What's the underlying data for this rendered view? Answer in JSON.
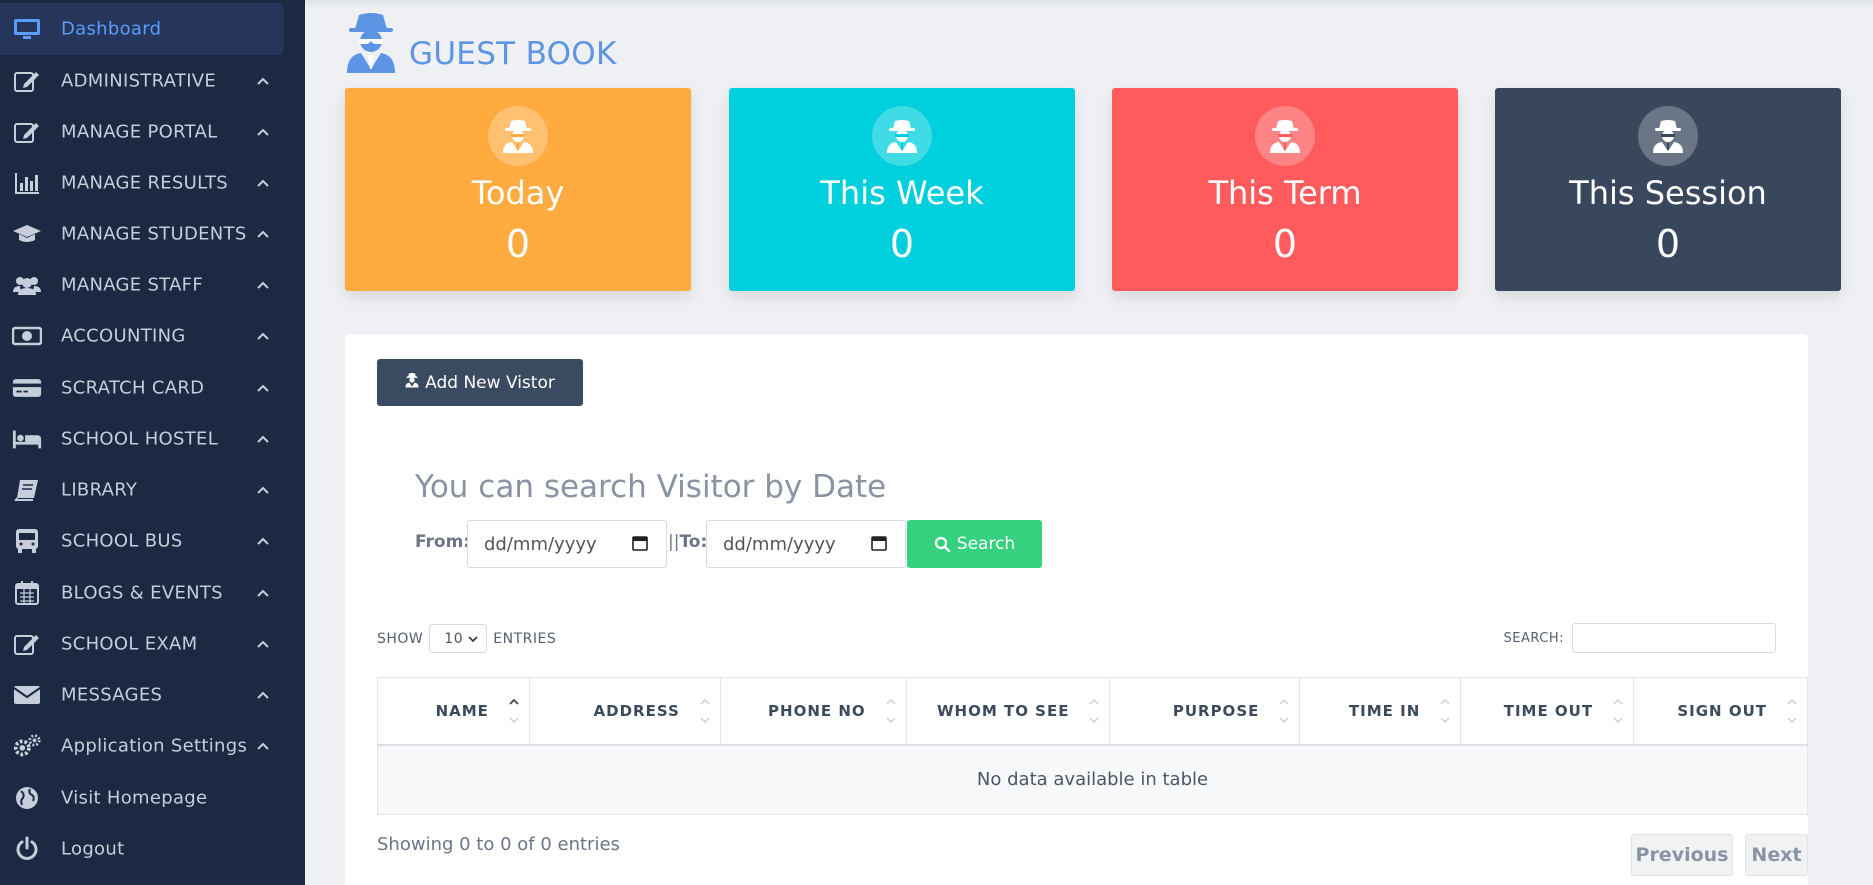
{
  "sidebar": {
    "items": [
      {
        "label": "Dashboard",
        "icon": "monitor-icon",
        "active": true,
        "chevron": false
      },
      {
        "label": "ADMINISTRATIVE",
        "icon": "edit-icon",
        "chevron": true
      },
      {
        "label": "MANAGE PORTAL",
        "icon": "edit-icon",
        "chevron": true
      },
      {
        "label": "MANAGE RESULTS",
        "icon": "bar-chart-icon",
        "chevron": true
      },
      {
        "label": "MANAGE STUDENTS",
        "icon": "graduation-cap-icon",
        "chevron": true
      },
      {
        "label": "MANAGE STAFF",
        "icon": "users-icon",
        "chevron": true
      },
      {
        "label": "ACCOUNTING",
        "icon": "money-icon",
        "chevron": true
      },
      {
        "label": "SCRATCH CARD",
        "icon": "credit-card-icon",
        "chevron": true
      },
      {
        "label": "SCHOOL HOSTEL",
        "icon": "bed-icon",
        "chevron": true
      },
      {
        "label": "LIBRARY",
        "icon": "book-icon",
        "chevron": true
      },
      {
        "label": "SCHOOL BUS",
        "icon": "bus-icon",
        "chevron": true
      },
      {
        "label": "BLOGS & EVENTS",
        "icon": "calendar-icon",
        "chevron": true
      },
      {
        "label": "SCHOOL EXAM",
        "icon": "edit-icon",
        "chevron": true
      },
      {
        "label": "MESSAGES",
        "icon": "envelope-icon",
        "chevron": true
      },
      {
        "label": "Application Settings",
        "icon": "gears-icon",
        "chevron": true
      },
      {
        "label": "Visit Homepage",
        "icon": "globe-icon",
        "chevron": false
      },
      {
        "label": "Logout",
        "icon": "power-icon",
        "chevron": false
      }
    ]
  },
  "header": {
    "title": "GUEST BOOK",
    "icon": "user-secret-icon"
  },
  "stats": [
    {
      "label": "Today",
      "value": "0",
      "color": "#ffab40"
    },
    {
      "label": "This Week",
      "value": "0",
      "color": "#00cfdd"
    },
    {
      "label": "This Term",
      "value": "0",
      "color": "#ff5b5c"
    },
    {
      "label": "This Session",
      "value": "0",
      "color": "#39475d"
    }
  ],
  "actions": {
    "add_visitor": "Add New Vistor"
  },
  "search": {
    "heading": "You can search Visitor by Date",
    "from_label": "From:",
    "separator": "||",
    "to_label": "To:",
    "date_placeholder": "dd/mm/yyyy",
    "button": "Search"
  },
  "table": {
    "show_label": "SHOW",
    "entries_value": "10",
    "entries_label": "ENTRIES",
    "search_label": "SEARCH:",
    "columns": [
      "NAME",
      "ADDRESS",
      "PHONE NO",
      "WHOM TO SEE",
      "PURPOSE",
      "TIME IN",
      "TIME OUT",
      "SIGN OUT"
    ],
    "empty_message": "No data available in table",
    "info": "Showing 0 to 0 of 0 entries",
    "prev": "Previous",
    "next": "Next"
  },
  "colors": {
    "sidebar_bg": "#1b2942",
    "accent": "#5c9cff",
    "success": "#36d17f"
  }
}
